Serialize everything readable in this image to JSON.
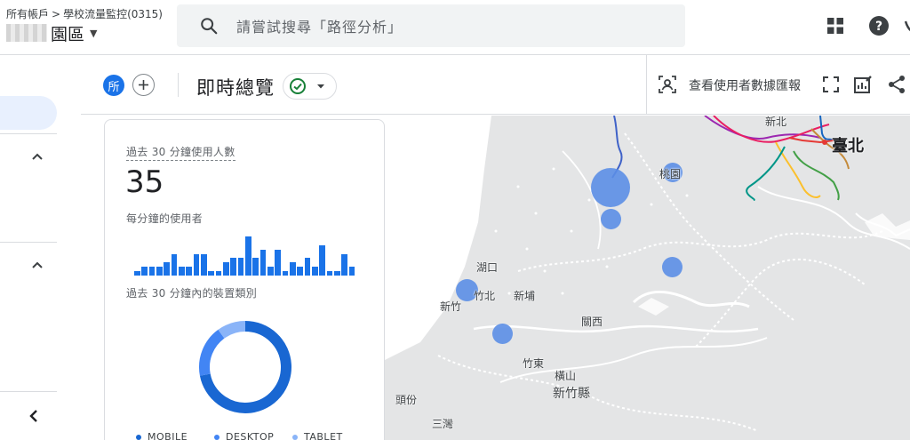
{
  "header": {
    "breadcrumb_account": "所有帳戶",
    "breadcrumb_sep": ">",
    "breadcrumb_property": "學校流量監控(0315)",
    "property_name": "園區",
    "search_placeholder": "請嘗試搜尋「路徑分析」"
  },
  "report": {
    "segment_chip": "所",
    "title": "即時總覽",
    "view_user_snapshot": "查看使用者數據匯報"
  },
  "card": {
    "users_label": "過去 30 分鐘使用人數",
    "users_value": "35",
    "per_minute_label": "每分鐘的使用者",
    "per_minute_values": [
      1,
      2,
      2,
      2,
      3,
      5,
      2,
      2,
      5,
      5,
      1,
      1,
      3,
      4,
      4,
      9,
      4,
      6,
      2,
      6,
      1,
      3,
      2,
      4,
      2,
      7,
      1,
      1,
      5,
      2
    ],
    "device_label": "過去 30 分鐘內的裝置類別",
    "device_share": [
      {
        "name": "MOBILE",
        "value": 0.72,
        "color": "#1967d2"
      },
      {
        "name": "DESKTOP",
        "value": 0.18,
        "color": "#4285f4"
      },
      {
        "name": "TABLET",
        "value": 0.1,
        "color": "#8ab4f8"
      }
    ]
  },
  "map": {
    "places": [
      "新北",
      "臺北",
      "桃園",
      "湖口",
      "竹北",
      "新埔",
      "新竹",
      "關西",
      "竹東",
      "橫山",
      "新竹縣",
      "頭份",
      "三灣"
    ]
  },
  "icons": {
    "search": "search-icon",
    "apps": "apps-grid-icon",
    "help": "help-icon",
    "add": "add-icon",
    "status": "check-circle-icon",
    "snapshot": "user-snapshot-icon",
    "fullscreen": "fullscreen-icon",
    "customize": "edit-report-icon",
    "share": "share-icon",
    "collapse": "chevron-left-icon"
  },
  "colors": {
    "accent": "#1a73e8",
    "success": "#188038",
    "map_dot": "#5b8ee6"
  }
}
